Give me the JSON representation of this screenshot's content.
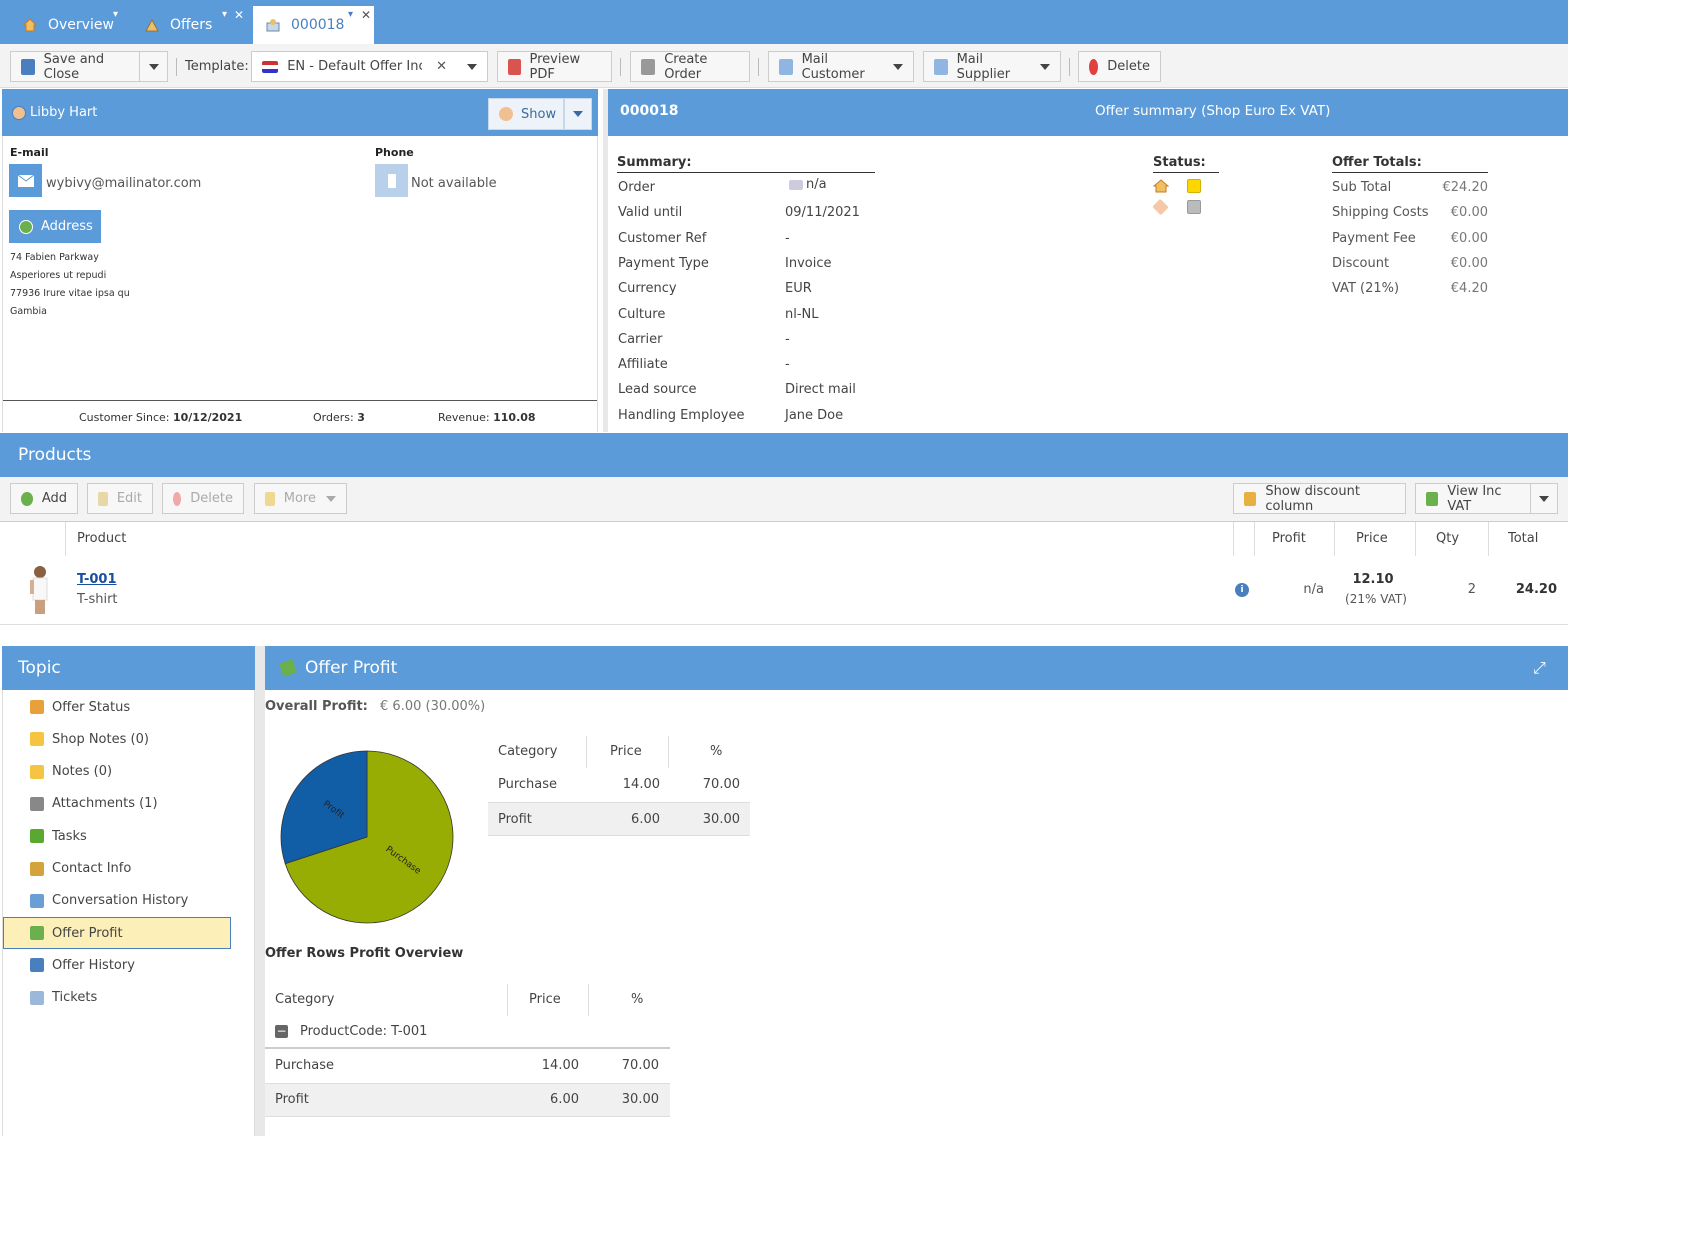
{
  "tabs": [
    {
      "label": "Overview",
      "icon": "home-icon"
    },
    {
      "label": "Offers",
      "icon": "offers-icon"
    },
    {
      "label": "000018",
      "icon": "offer-icon"
    }
  ],
  "toolbar": {
    "save_close": "Save and Close",
    "template_label": "Template:",
    "template_value": "EN - Default Offer Inc V",
    "preview_pdf": "Preview PDF",
    "create_order": "Create Order",
    "mail_customer": "Mail Customer",
    "mail_supplier": "Mail Supplier",
    "delete": "Delete"
  },
  "customer": {
    "name": "Libby Hart",
    "show": "Show",
    "email_label": "E-mail",
    "email": "wybivy@mailinator.com",
    "phone_label": "Phone",
    "phone": "Not available",
    "address_button": "Address",
    "address_lines": [
      "74 Fabien Parkway",
      "Asperiores ut repudi",
      "77936 Irure vitae ipsa qu",
      "Gambia"
    ],
    "since_label": "Customer Since:",
    "since": "10/12/2021",
    "orders_label": "Orders:",
    "orders": "3",
    "revenue_label": "Revenue:",
    "revenue": "110.08"
  },
  "offer": {
    "number": "000018",
    "summary_title": "Offer summary (Shop Euro Ex VAT)",
    "summary_heading": "Summary:",
    "status_heading": "Status:",
    "totals_heading": "Offer Totals:",
    "summary": [
      {
        "label": "Order",
        "value": "n/a"
      },
      {
        "label": "Valid until",
        "value": "09/11/2021"
      },
      {
        "label": "Customer Ref",
        "value": "-"
      },
      {
        "label": "Payment Type",
        "value": "Invoice"
      },
      {
        "label": "Currency",
        "value": "EUR"
      },
      {
        "label": "Culture",
        "value": "nl-NL"
      },
      {
        "label": "Carrier",
        "value": "-"
      },
      {
        "label": "Affiliate",
        "value": "-"
      },
      {
        "label": "Lead source",
        "value": "Direct mail"
      },
      {
        "label": "Handling Employee",
        "value": "Jane Doe"
      }
    ],
    "totals": [
      {
        "label": "Sub Total",
        "value": "€24.20"
      },
      {
        "label": "Shipping Costs",
        "value": "€0.00"
      },
      {
        "label": "Payment Fee",
        "value": "€0.00"
      },
      {
        "label": "Discount",
        "value": "€0.00"
      },
      {
        "label": "VAT (21%)",
        "value": "€4.20"
      }
    ]
  },
  "products": {
    "title": "Products",
    "add": "Add",
    "edit": "Edit",
    "delete": "Delete",
    "more": "More",
    "show_discount": "Show discount column",
    "view_inc_vat": "View Inc VAT",
    "headers": {
      "product": "Product",
      "profit": "Profit",
      "price": "Price",
      "qty": "Qty",
      "total": "Total"
    },
    "rows": [
      {
        "code": "T-001",
        "name": "T-shirt",
        "profit": "n/a",
        "price": "12.10",
        "vat": "(21% VAT)",
        "qty": "2",
        "total": "24.20"
      }
    ]
  },
  "topic": {
    "title": "Topic",
    "items": [
      {
        "label": "Offer Status",
        "icon": "grid-icon",
        "color": "#e8a13a"
      },
      {
        "label": "Shop Notes (0)",
        "icon": "note-icon",
        "color": "#f5c542"
      },
      {
        "label": "Notes (0)",
        "icon": "note-icon",
        "color": "#f5c542"
      },
      {
        "label": "Attachments (1)",
        "icon": "paperclip-icon",
        "color": "#888888"
      },
      {
        "label": "Tasks",
        "icon": "arrow-icon",
        "color": "#5aa832"
      },
      {
        "label": "Contact Info",
        "icon": "contact-icon",
        "color": "#d4a33c"
      },
      {
        "label": "Conversation History",
        "icon": "mail-icon",
        "color": "#6a9fd4"
      },
      {
        "label": "Offer Profit",
        "icon": "money-icon",
        "color": "#6ab04c"
      },
      {
        "label": "Offer History",
        "icon": "history-icon",
        "color": "#4a7fbf"
      },
      {
        "label": "Tickets",
        "icon": "tag-icon",
        "color": "#9bb8dc"
      }
    ]
  },
  "profit": {
    "title": "Offer Profit",
    "overall_label": "Overall Profit:",
    "overall_value": "€ 6.00 (30.00%)",
    "table_headers": {
      "category": "Category",
      "price": "Price",
      "pct": "%"
    },
    "rows_title": "Offer Rows Profit Overview",
    "group_label": "ProductCode: T-001"
  },
  "chart_data": {
    "type": "pie",
    "slices": [
      {
        "label": "Purchase",
        "value": 70.0,
        "price": "14.00",
        "pct": "70.00",
        "color": "#97ad04"
      },
      {
        "label": "Profit",
        "value": 30.0,
        "price": "6.00",
        "pct": "30.00",
        "color": "#125ea6"
      }
    ]
  },
  "rows_breakdown": [
    {
      "category": "Purchase",
      "price": "14.00",
      "pct": "70.00"
    },
    {
      "category": "Profit",
      "price": "6.00",
      "pct": "30.00"
    }
  ],
  "colors": {
    "header_blue": "#5b9bd9",
    "selected": "#fdefb8"
  }
}
